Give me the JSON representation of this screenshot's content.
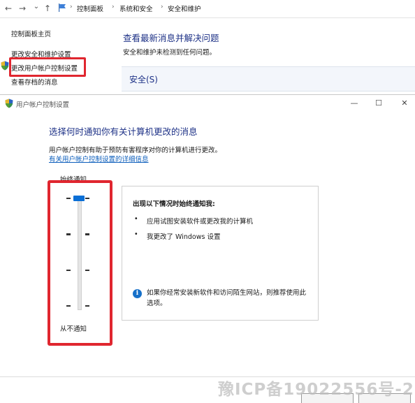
{
  "nav": {
    "back_glyph": "←",
    "forward_glyph": "→",
    "dropdown_glyph": "⌄",
    "up_glyph": "↑"
  },
  "breadcrumb": {
    "items": [
      "控制面板",
      "系统和安全",
      "安全和维护"
    ],
    "separator": "›"
  },
  "control_panel": {
    "left_links": [
      "控制面板主页",
      "更改安全和维护设置",
      "更改用户帐户控制设置",
      "查看存档的消息"
    ],
    "right_title": "查看最新消息并解决问题",
    "right_text": "安全和维护未检测到任何问题。",
    "section_label": "安全(S)"
  },
  "uac": {
    "window_title": "用户帐户控制设置",
    "minimize_glyph": "—",
    "maximize_glyph": "☐",
    "close_glyph": "✕",
    "heading": "选择何时通知你有关计算机更改的消息",
    "description": "用户帐户控制有助于预防有害程序对你的计算机进行更改。",
    "learn_more_link": "有关用户帐户控制设置的详细信息",
    "slider": {
      "top_label": "始终通知",
      "bottom_label": "从不通知",
      "levels": 4,
      "selected_level": 4
    },
    "info": {
      "title": "出现以下情况时始终通知我:",
      "items": [
        "应用试图安装软件或更改我的计算机",
        "我更改了 Windows 设置"
      ],
      "bullet": "•",
      "note_icon": "i",
      "note": "如果你经常安装新软件和访问陌生网站，则推荐使用此选项。"
    }
  },
  "watermark": "豫ICP备19022556号-2",
  "colors": {
    "highlight": "#e0262f",
    "link": "#0b5dbb",
    "heading": "#1e3287",
    "slider_thumb": "#0a6fd6"
  },
  "icons": [
    "back-icon",
    "forward-icon",
    "up-icon",
    "flag-icon",
    "shield-icon",
    "info-icon"
  ]
}
